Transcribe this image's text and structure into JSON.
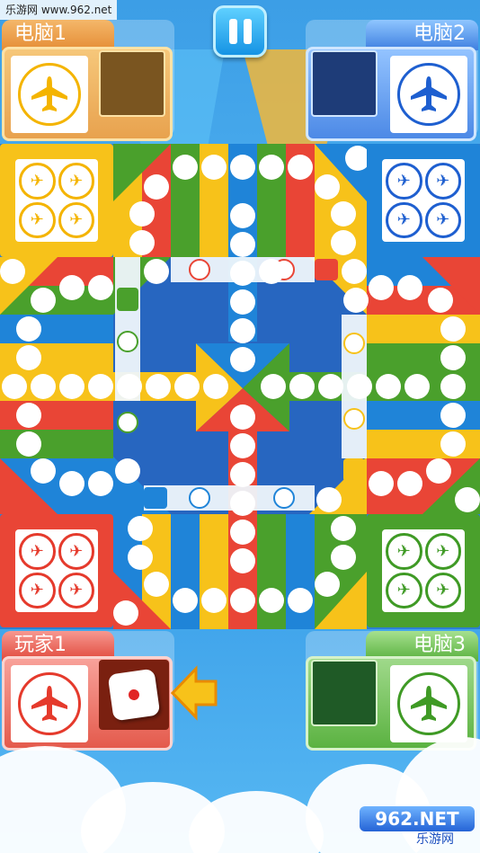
{
  "watermark_top": "乐游网 www.962.net",
  "watermark_bottom": {
    "brand": "962.NET",
    "sub": "乐游网"
  },
  "players": {
    "top_left": {
      "name": "电脑1",
      "color": "#f4b400",
      "slot_color": "#7a5520"
    },
    "top_right": {
      "name": "电脑2",
      "color": "#1e5fd0",
      "slot_color": "#1e3c78"
    },
    "bottom_left": {
      "name": "玩家1",
      "color": "#e53a2c",
      "slot_color": "#7a2010"
    },
    "bottom_right": {
      "name": "电脑3",
      "color": "#3f9a25",
      "slot_color": "#1f5a26"
    }
  },
  "colors": {
    "yellow": "#f7c21a",
    "blue": "#1f84d8",
    "red": "#e94536",
    "green": "#4aa02c",
    "board_bg": "#2d7fd0"
  },
  "icons": {
    "pause": "pause-icon",
    "plane": "plane-icon",
    "arrow": "left-arrow-indicator",
    "dice": "dice-icon"
  },
  "dice_value": 1
}
